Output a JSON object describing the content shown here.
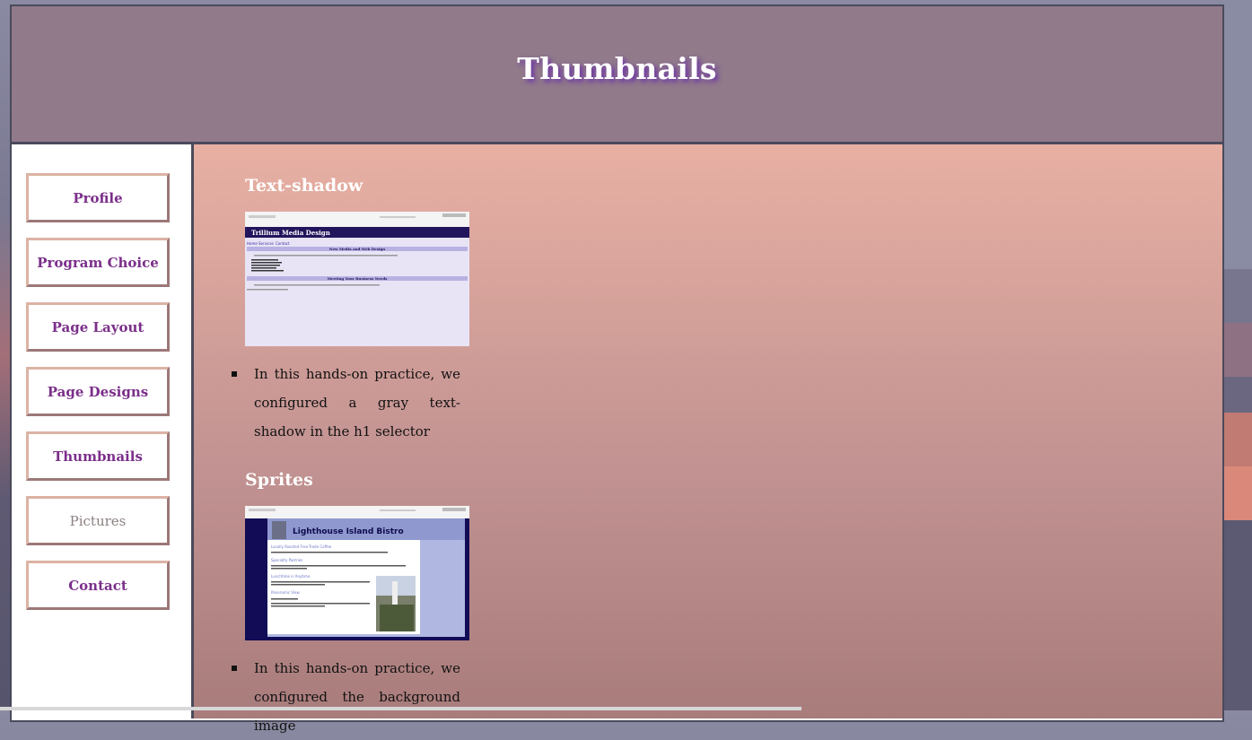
{
  "page": {
    "title": "Thumbnails"
  },
  "nav": {
    "items": [
      {
        "label": "Profile"
      },
      {
        "label": "Program Choice"
      },
      {
        "label": "Page Layout"
      },
      {
        "label": "Page Designs"
      },
      {
        "label": "Thumbnails"
      },
      {
        "label": "Pictures"
      },
      {
        "label": "Contact"
      }
    ]
  },
  "main": {
    "sections": [
      {
        "heading": "Text-shadow",
        "thumb": {
          "site_title": "Trillium Media Design",
          "nav": [
            "Home",
            "Services",
            "Contact"
          ],
          "heading1": "New Media and Web Design",
          "heading2": "Meeting Your Business Needs"
        },
        "bullet": "In this hands-on practice, we configured a gray text-shadow in the h1 selector"
      },
      {
        "heading": "Sprites",
        "thumb": {
          "site_title": "Lighthouse Island Bistro",
          "subheads": [
            "Locally Roasted Free-Trade Coffee",
            "Specialty Pastries",
            "Lunchtime is Anytime",
            "Panoramic View"
          ]
        },
        "bullet": "In this hands-on practice, we configured the background image"
      }
    ]
  },
  "colors": {
    "header_bg": "#917a8a",
    "nav_text": "#7b2f8a",
    "nav_current_text": "#8c8080",
    "main_bg_top": "#e8b0a3",
    "main_bg_bottom": "#a97c7c",
    "title_shadow": "#6a2fa7"
  }
}
